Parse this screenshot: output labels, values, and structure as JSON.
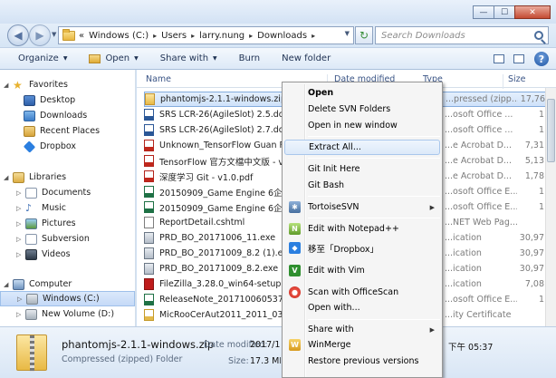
{
  "window": {
    "minimize": "—",
    "maximize": "☐",
    "close": "✕"
  },
  "address": {
    "prefix": "«",
    "crumbs": [
      "Windows (C:)",
      "Users",
      "larry.nung",
      "Downloads"
    ],
    "search_placeholder": "Search Downloads"
  },
  "toolbar": {
    "organize": "Organize",
    "open": "Open",
    "share_with": "Share with",
    "burn": "Burn",
    "new_folder": "New folder"
  },
  "nav": {
    "favorites": "Favorites",
    "desktop": "Desktop",
    "downloads": "Downloads",
    "recent_places": "Recent Places",
    "dropbox": "Dropbox",
    "libraries": "Libraries",
    "documents": "Documents",
    "music": "Music",
    "pictures": "Pictures",
    "subversion": "Subversion",
    "videos": "Videos",
    "computer": "Computer",
    "windows_c": "Windows  (C:)",
    "new_volume": "New Volume (D:)"
  },
  "columns": {
    "name": "Name",
    "date_modified": "Date modified",
    "type": "Type",
    "size": "Size"
  },
  "files": [
    {
      "name": "phantomjs-2.1.1-windows.zip",
      "type": "...pressed (zipp...",
      "size": "17,76",
      "icon": "zip",
      "selected": true
    },
    {
      "name": "SRS LCR-26(AgileSlot) 2.5.docx",
      "type": "...osoft Office ...",
      "size": "1",
      "icon": "word"
    },
    {
      "name": "SRS LCR-26(AgileSlot) 2.7.docx",
      "type": "...osoft Office ...",
      "size": "1",
      "icon": "word"
    },
    {
      "name": "Unknown_TensorFlow Guan Fan",
      "type": "...e Acrobat D...",
      "size": "7,31",
      "icon": "pdf"
    },
    {
      "name": "TensorFlow 官方文檔中文版 - v...",
      "type": "...e Acrobat D...",
      "size": "5,13",
      "icon": "pdf"
    },
    {
      "name": "深度学习 Git - v1.0.pdf",
      "type": "...e Acrobat D...",
      "size": "1,78",
      "icon": "pdf"
    },
    {
      "name": "20150909_Game Engine 6企劃書...",
      "type": "...osoft Office E...",
      "size": "1",
      "icon": "excel"
    },
    {
      "name": "20150909_Game Engine 6企劃書...",
      "type": "...osoft Office E...",
      "size": "1",
      "icon": "excel"
    },
    {
      "name": "ReportDetail.cshtml",
      "type": "...NET Web Pag...",
      "size": "",
      "icon": "web"
    },
    {
      "name": "PRD_BO_20171006_11.exe",
      "type": "...ication",
      "size": "30,97",
      "icon": "exe"
    },
    {
      "name": "PRD_BO_20171009_8.2 (1).exe",
      "type": "...ication",
      "size": "30,97",
      "icon": "exe"
    },
    {
      "name": "PRD_BO_20171009_8.2.exe",
      "type": "...ication",
      "size": "30,97",
      "icon": "exe"
    },
    {
      "name": "FileZilla_3.28.0_win64-setup.exe",
      "type": "...ication",
      "size": "7,08",
      "icon": "filezilla"
    },
    {
      "name": "ReleaseNote_20171006053750.xl",
      "type": "...osoft Office E...",
      "size": "1",
      "icon": "excel"
    },
    {
      "name": "MicRooCerAut2011_2011_03_22",
      "type": "...ity Certificate",
      "size": "",
      "icon": "cert"
    }
  ],
  "details": {
    "name": "phantomjs-2.1.1-windows.zip",
    "type": "Compressed (zipped) Folder",
    "date_label": "Date modified:",
    "date_value": "2017/10/...",
    "size_label": "Size:",
    "size_value": "17.3 MB",
    "created_tail": "下午 05:37"
  },
  "context_menu": {
    "open": "Open",
    "delete_svn": "Delete SVN Folders",
    "open_new_window": "Open in new window",
    "extract_all": "Extract All...",
    "git_init": "Git Init Here",
    "git_bash": "Git Bash",
    "tortoise": "TortoiseSVN",
    "notepadpp": "Edit with Notepad++",
    "dropbox": "移至「Dropbox」",
    "vim": "Edit with Vim",
    "officescan": "Scan with OfficeScan",
    "open_with": "Open with...",
    "share_with": "Share with",
    "winmerge": "WinMerge",
    "restore": "Restore previous versions",
    "arrow": "▶"
  },
  "colors": {
    "selection": "#cfe2fa",
    "accent": "#1f56a5"
  }
}
